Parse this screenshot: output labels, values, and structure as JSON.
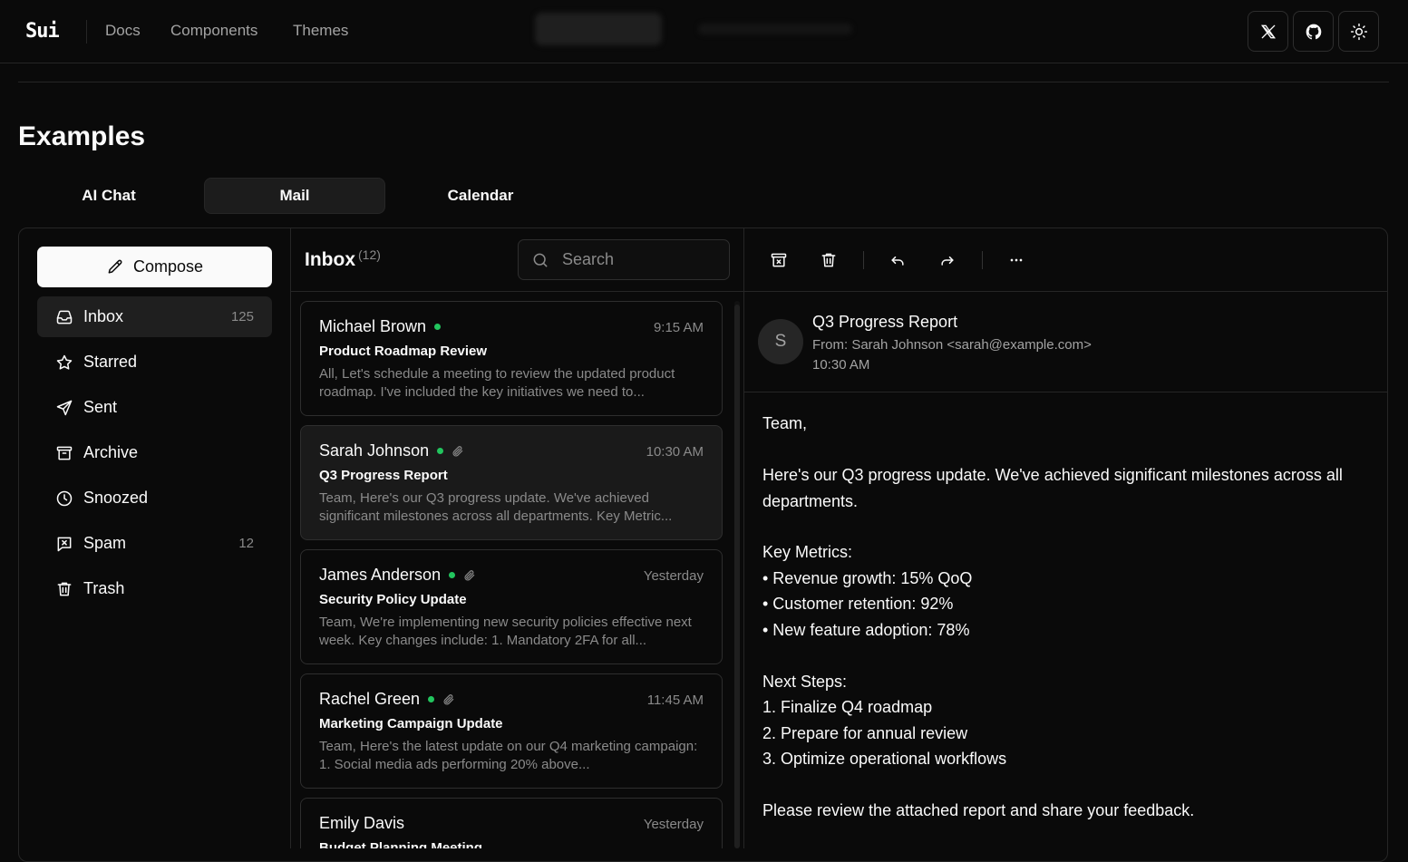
{
  "nav": {
    "logo": "Sui",
    "links": [
      "Docs",
      "Components",
      "Themes"
    ]
  },
  "page": {
    "title": "Examples"
  },
  "tabs": [
    {
      "label": "AI Chat",
      "active": false
    },
    {
      "label": "Mail",
      "active": true
    },
    {
      "label": "Calendar",
      "active": false
    }
  ],
  "sidebar": {
    "compose_label": "Compose",
    "items": [
      {
        "label": "Inbox",
        "count": "125",
        "icon": "inbox-icon",
        "active": true
      },
      {
        "label": "Starred",
        "count": "",
        "icon": "star-icon",
        "active": false
      },
      {
        "label": "Sent",
        "count": "",
        "icon": "send-icon",
        "active": false
      },
      {
        "label": "Archive",
        "count": "",
        "icon": "archive-icon",
        "active": false
      },
      {
        "label": "Snoozed",
        "count": "",
        "icon": "clock-icon",
        "active": false
      },
      {
        "label": "Spam",
        "count": "12",
        "icon": "spam-icon",
        "active": false
      },
      {
        "label": "Trash",
        "count": "",
        "icon": "trash-icon",
        "active": false
      }
    ]
  },
  "mail_list": {
    "title": "Inbox",
    "count": "(12)",
    "search_placeholder": "Search",
    "emails": [
      {
        "sender": "Michael Brown",
        "time": "9:15 AM",
        "subject": "Product Roadmap Review",
        "preview": "All, Let's schedule a meeting to review the updated product roadmap. I've included the key initiatives we need to...",
        "unread": true,
        "attachment": false,
        "selected": false
      },
      {
        "sender": "Sarah Johnson",
        "time": "10:30 AM",
        "subject": "Q3 Progress Report",
        "preview": "Team, Here's our Q3 progress update. We've achieved significant milestones across all departments. Key Metric...",
        "unread": true,
        "attachment": true,
        "selected": true
      },
      {
        "sender": "James Anderson",
        "time": "Yesterday",
        "subject": "Security Policy Update",
        "preview": "Team, We're implementing new security policies effective next week. Key changes include: 1. Mandatory 2FA for all...",
        "unread": true,
        "attachment": true,
        "selected": false
      },
      {
        "sender": "Rachel Green",
        "time": "11:45 AM",
        "subject": "Marketing Campaign Update",
        "preview": "Team, Here's the latest update on our Q4 marketing campaign: 1. Social media ads performing 20% above...",
        "unread": true,
        "attachment": true,
        "selected": false
      },
      {
        "sender": "Emily Davis",
        "time": "Yesterday",
        "subject": "Budget Planning Meeting",
        "preview": "",
        "unread": false,
        "attachment": false,
        "selected": false
      }
    ]
  },
  "reader": {
    "avatar_initial": "S",
    "subject": "Q3 Progress Report",
    "from": "From: Sarah Johnson <sarah@example.com>",
    "time": "10:30 AM",
    "body_lines": [
      "Team,",
      "",
      "Here's our Q3 progress update. We've achieved significant milestones across all",
      "departments.",
      "",
      "Key Metrics:",
      "• Revenue growth: 15% QoQ",
      "• Customer retention: 92%",
      "• New feature adoption: 78%",
      "",
      "Next Steps:",
      "1. Finalize Q4 roadmap",
      "2. Prepare for annual review",
      "3. Optimize operational workflows",
      "",
      "Please review the attached report and share your feedback."
    ]
  },
  "colors": {
    "background": "#0a0a0a",
    "border": "#262626",
    "muted_text": "#8a8a8a",
    "unread_dot": "#22c55e",
    "compose_bg": "#fafafa"
  }
}
